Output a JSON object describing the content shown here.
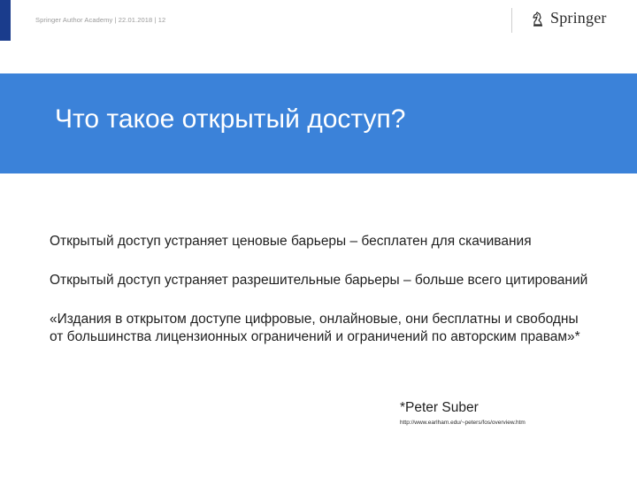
{
  "header": {
    "meta": "Springer Author Academy | 22.01.2018 | 12",
    "logo_text": "Springer",
    "logo_icon": "chess-knight-icon"
  },
  "slide": {
    "title": "Что такое открытый доступ?",
    "paragraphs": [
      "Открытый доступ устраняет ценовые барьеры – бесплатен для скачивания",
      "Открытый доступ устраняет разрешительные барьеры – больше всего цитирований",
      "«Издания в открытом доступе цифровые, онлайновые, они бесплатны и свободны от большинства лицензионных ограничений и ограничений по авторским правам»*"
    ],
    "attribution": "*Peter Suber",
    "source_url": "http://www.earlham.edu/~peters/fos/overview.htm"
  },
  "colors": {
    "title_band": "#3b82d9",
    "left_bar": "#1a3c8c"
  }
}
